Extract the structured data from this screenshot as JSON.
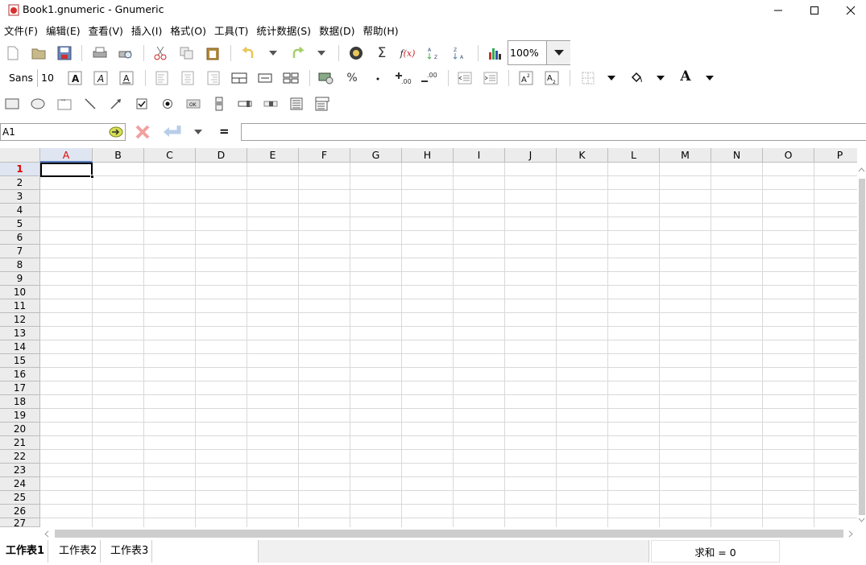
{
  "window": {
    "title": "Book1.gnumeric - Gnumeric"
  },
  "menu": [
    "文件(F)",
    "编辑(E)",
    "查看(V)",
    "插入(I)",
    "格式(O)",
    "工具(T)",
    "统计数据(S)",
    "数据(D)",
    "帮助(H)"
  ],
  "toolbar": {
    "zoom": "100%",
    "font_name": "Sans",
    "font_size": "10",
    "percent": "%"
  },
  "formula": {
    "cell_ref": "A1",
    "equals": "="
  },
  "columns": [
    "A",
    "B",
    "C",
    "D",
    "E",
    "F",
    "G",
    "H",
    "I",
    "J",
    "K",
    "L",
    "M",
    "N",
    "O",
    "P"
  ],
  "rows": [
    "1",
    "2",
    "3",
    "4",
    "5",
    "6",
    "7",
    "8",
    "9",
    "10",
    "11",
    "12",
    "13",
    "14",
    "15",
    "16",
    "17",
    "18",
    "19",
    "20",
    "21",
    "22",
    "23",
    "24",
    "25",
    "26",
    "27"
  ],
  "selected": {
    "col": "A",
    "row": "1"
  },
  "sheets": [
    "工作表1",
    "工作表2",
    "工作表3"
  ],
  "status": {
    "sum": "求和 = 0"
  },
  "colors": {
    "accent_red": "#e00000",
    "selection_blue": "#5a7dbd"
  }
}
